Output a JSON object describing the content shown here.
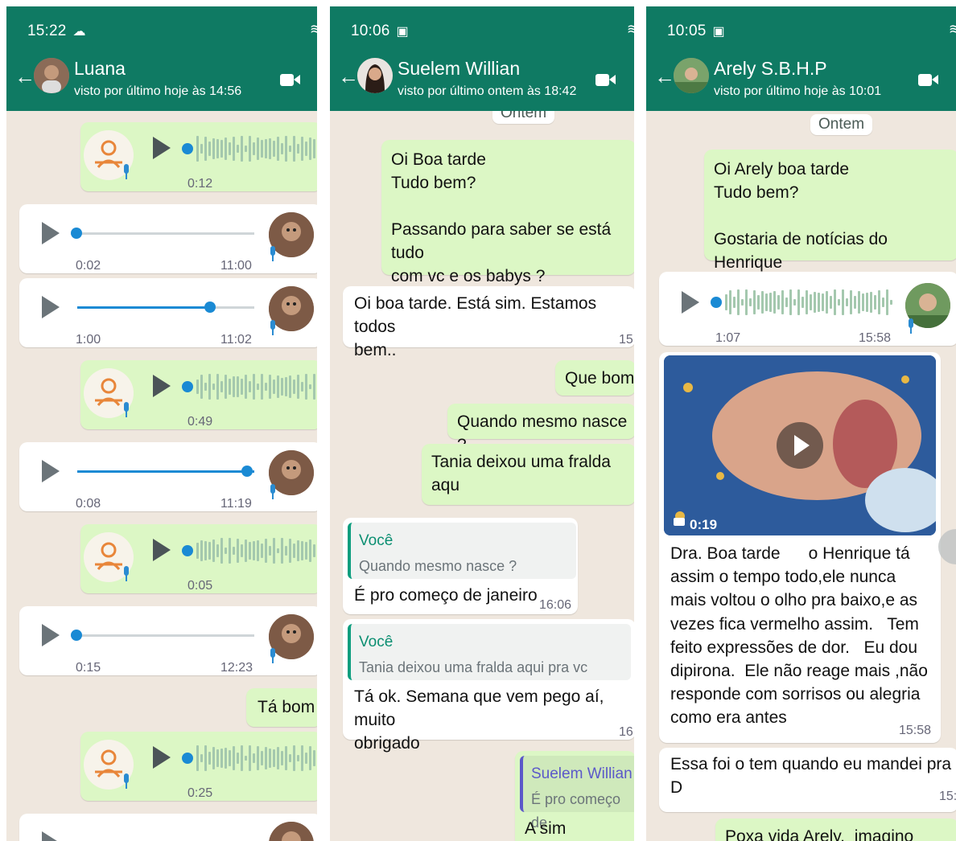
{
  "colors": {
    "header": "#0f7a63",
    "outgoing_bubble": "#dcf7c5",
    "incoming_bubble": "#ffffff",
    "chat_bg": "#efe7de",
    "audio_accent": "#1a8ad4",
    "quote_accent": "#0c9e7e"
  },
  "panels": [
    {
      "status_time": "15:22",
      "status_icon": "cloud-icon",
      "contact_name": "Luana",
      "last_seen": "visto por último hoje às 14:56",
      "messages": [
        {
          "type": "voice-out",
          "duration": "0:12"
        },
        {
          "type": "audio-in",
          "elapsed": "0:02",
          "time": "11:00",
          "progress": 0.0
        },
        {
          "type": "audio-in",
          "elapsed": "1:00",
          "time": "11:02",
          "progress": 0.75
        },
        {
          "type": "voice-out",
          "duration": "0:49"
        },
        {
          "type": "audio-in",
          "elapsed": "0:08",
          "time": "11:19",
          "progress": 1.0
        },
        {
          "type": "voice-out",
          "duration": "0:05"
        },
        {
          "type": "audio-in",
          "elapsed": "0:15",
          "time": "12:23",
          "progress": 0.0
        },
        {
          "type": "text-out",
          "text": "Tá bom"
        },
        {
          "type": "voice-out",
          "duration": "0:25"
        }
      ]
    },
    {
      "status_time": "10:06",
      "status_icon": "image-icon",
      "contact_name": "Suelem Willian",
      "last_seen": "visto por último ontem às 18:42",
      "date_pill": "Ontem",
      "messages": [
        {
          "type": "text-out",
          "text": "Oi Boa tarde\nTudo bem?\n\nPassando para saber se está tudo\ncom vc e os babys ?"
        },
        {
          "type": "text-in",
          "text": "Oi boa tarde. Está sim. Estamos todos\nbem..",
          "time": "15"
        },
        {
          "type": "text-out",
          "text": "Que bom"
        },
        {
          "type": "text-out",
          "text": "Quando mesmo nasce ?"
        },
        {
          "type": "text-out",
          "text": "Tania deixou uma fralda aqu"
        },
        {
          "type": "reply-in",
          "quote_author": "Você",
          "quote_text": "Quando mesmo nasce ?",
          "text": "É pro começo de janeiro",
          "time": "16:06"
        },
        {
          "type": "reply-in",
          "quote_author": "Você",
          "quote_text": "Tania deixou uma fralda aqui pra vc",
          "text": "Tá ok. Semana que vem pego aí, muito\nobrigado",
          "time": "16"
        },
        {
          "type": "reply-out",
          "quote_author": "Suelem Willian",
          "quote_text": "É pro começo de",
          "text": "A sim"
        }
      ]
    },
    {
      "status_time": "10:05",
      "status_icon": "image-icon",
      "contact_name": "Arely S.B.H.P",
      "last_seen": "visto por último hoje às 10:01",
      "date_pill": "Ontem",
      "messages": [
        {
          "type": "text-out",
          "text": "Oi Arely boa tarde\nTudo bem?\n\nGostaria de notícias do Henrique"
        },
        {
          "type": "audio-in",
          "elapsed": "1:07",
          "time": "15:58",
          "progress": 0.0
        },
        {
          "type": "video-in",
          "video_duration": "0:19",
          "text": "Dra. Boa tarde      o Henrique tá\nassim o tempo todo,ele nunca\nmais voltou o olho pra baixo,e as\nvezes fica vermelho assim.   Tem\nfeito expressões de dor.   Eu dou\ndipirona.  Ele não reage mais ,não\nresponde com sorrisos ou alegria\ncomo era antes",
          "time": "15:58"
        },
        {
          "type": "text-in",
          "text": "Essa foi o tem quando eu mandei pra D",
          "time": "15:"
        },
        {
          "type": "text-out",
          "text": "Poxa vida Arely,  imagino como v"
        }
      ]
    }
  ]
}
